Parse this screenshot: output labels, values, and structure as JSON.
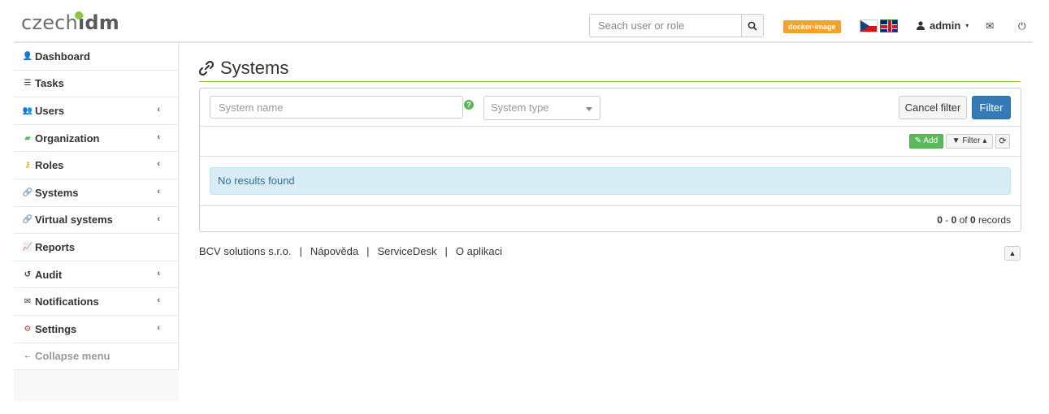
{
  "header": {
    "logo_light": "czech",
    "logo_bold": "idm",
    "search_placeholder": "Seach user or role",
    "env_badge": "docker-image",
    "user": "admin",
    "icons": [
      "search-icon",
      "user-icon",
      "envelope-icon",
      "power-icon"
    ]
  },
  "sidebar": {
    "items": [
      {
        "label": "Dashboard",
        "icon": "user-icon",
        "has_children": false
      },
      {
        "label": "Tasks",
        "icon": "list-icon",
        "has_children": false
      },
      {
        "label": "Users",
        "icon": "users-icon",
        "has_children": true
      },
      {
        "label": "Organization",
        "icon": "folder-icon",
        "has_children": true
      },
      {
        "label": "Roles",
        "icon": "key-icon",
        "has_children": true
      },
      {
        "label": "Systems",
        "icon": "link-icon",
        "has_children": true
      },
      {
        "label": "Virtual systems",
        "icon": "link-icon",
        "has_children": true
      },
      {
        "label": "Reports",
        "icon": "chart-icon",
        "has_children": false
      },
      {
        "label": "Audit",
        "icon": "history-icon",
        "has_children": true
      },
      {
        "label": "Notifications",
        "icon": "envelope-icon",
        "has_children": true
      },
      {
        "label": "Settings",
        "icon": "gear-icon",
        "has_children": true
      },
      {
        "label": "Collapse menu",
        "icon": "arrow-left-icon",
        "has_children": false
      }
    ]
  },
  "main": {
    "title": "Systems",
    "filter": {
      "name_placeholder": "System name",
      "type_placeholder": "System type",
      "cancel_label": "Cancel filter",
      "filter_label": "Filter"
    },
    "toolbar": {
      "add_label": "Add",
      "filter_toggle_label": "Filter"
    },
    "empty_message": "No results found",
    "records": {
      "from": "0",
      "to": "0",
      "total": "0",
      "suffix": "records",
      "of": "of"
    }
  },
  "footer": {
    "links": [
      "BCV solutions s.r.o.",
      "Nápověda",
      "ServiceDesk",
      "O aplikaci"
    ]
  },
  "colors": {
    "accent_green": "#8cc63f",
    "primary_blue": "#337ab7",
    "badge_orange": "#f0a330",
    "success_green": "#5cb85c",
    "info_bg": "#d9edf7",
    "settings_red": "#c9302c",
    "roles_orange": "#e69500"
  }
}
